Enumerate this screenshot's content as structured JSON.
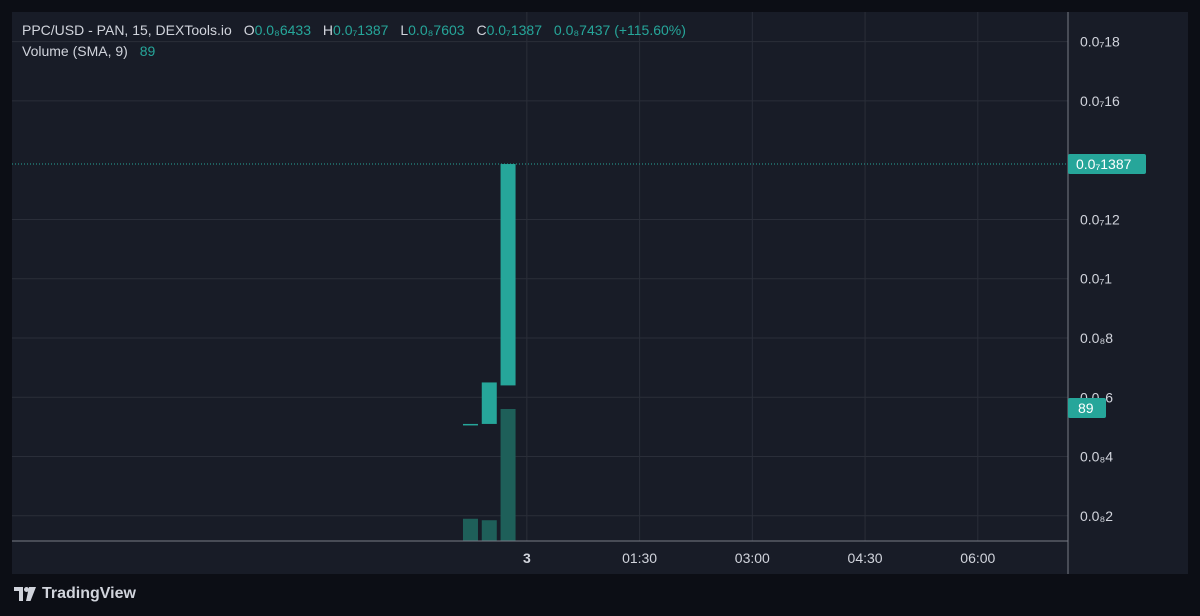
{
  "legend": {
    "symbol": "PPC/USD - PAN, 15, DEXTools.io",
    "open_label": "O",
    "open": "0.0₈6433",
    "high_label": "H",
    "high": "0.0₇1387",
    "low_label": "L",
    "low": "0.0₈7603",
    "close_label": "C",
    "close": "0.0₇1387",
    "change": "0.0₈7437 (+115.60%)",
    "volume_label": "Volume (SMA, 9)",
    "volume_value": "89"
  },
  "price_tag": "0.0₇1387",
  "volume_tag": "89",
  "brand": "TradingView",
  "colors": {
    "background": "#181c27",
    "grid": "#2a2e39",
    "text": "#d1d4dc",
    "up": "#26a69a",
    "volume_up": "#1e5f59",
    "axis_line": "#787b86"
  },
  "chart_data": {
    "type": "candlestick",
    "title": "PPC/USD - PAN, 15, DEXTools.io",
    "y_unit": "1e-8",
    "y_ticks": [
      2,
      4,
      6,
      8,
      10,
      12,
      16,
      18
    ],
    "y_tick_labels": [
      "0.0₈2",
      "0.0₈4",
      "0.0₈6",
      "0.0₈8",
      "0.0₇1",
      "0.0₇12",
      "0.0₇16",
      "0.0₇18"
    ],
    "ylim": [
      1.15,
      19.0
    ],
    "x_tick_labels": [
      "3",
      "01:30",
      "03:00",
      "04:30",
      "06:00"
    ],
    "x_tick_times": [
      "00:00",
      "01:30",
      "03:00",
      "04:30",
      "06:00"
    ],
    "xlim": [
      "-06:51",
      "07:12"
    ],
    "candles": [
      {
        "time": "23:15",
        "open": 5.1,
        "high": 5.1,
        "low": 5.1,
        "close": 5.1
      },
      {
        "time": "23:30",
        "open": 5.1,
        "high": 6.5,
        "low": 5.1,
        "close": 6.5
      },
      {
        "time": "23:45",
        "open": 6.4,
        "high": 13.87,
        "low": 6.4,
        "close": 13.87
      }
    ],
    "volume": [
      {
        "time": "23:15",
        "value": 15
      },
      {
        "time": "23:30",
        "value": 14
      },
      {
        "time": "23:45",
        "value": 89
      }
    ],
    "volume_max": 89,
    "last_price": 13.87,
    "last_price_label": "0.0₇1387",
    "grid": true
  }
}
